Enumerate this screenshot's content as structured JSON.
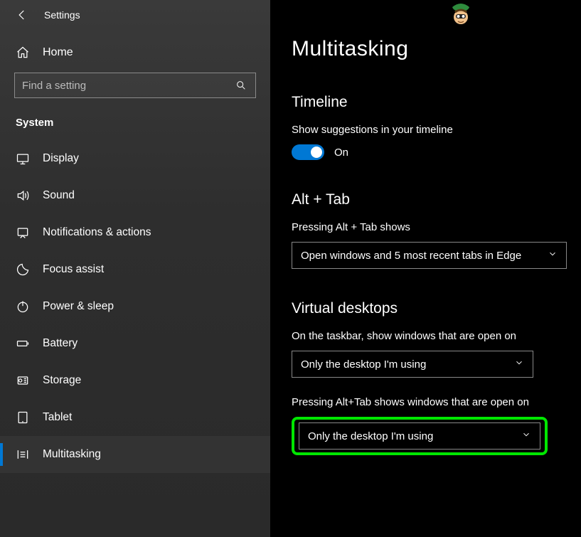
{
  "window": {
    "title": "Settings"
  },
  "sidebar": {
    "home_label": "Home",
    "search_placeholder": "Find a setting",
    "section_label": "System",
    "items": [
      {
        "label": "Display"
      },
      {
        "label": "Sound"
      },
      {
        "label": "Notifications & actions"
      },
      {
        "label": "Focus assist"
      },
      {
        "label": "Power & sleep"
      },
      {
        "label": "Battery"
      },
      {
        "label": "Storage"
      },
      {
        "label": "Tablet"
      },
      {
        "label": "Multitasking"
      }
    ]
  },
  "main": {
    "title": "Multitasking",
    "timeline": {
      "heading": "Timeline",
      "desc": "Show suggestions in your timeline",
      "toggle_state": "On"
    },
    "alttab": {
      "heading": "Alt + Tab",
      "desc": "Pressing Alt + Tab shows",
      "value": "Open windows and 5 most recent tabs in Edge"
    },
    "vdesktops": {
      "heading": "Virtual desktops",
      "desc1": "On the taskbar, show windows that are open on",
      "value1": "Only the desktop I'm using",
      "desc2": "Pressing Alt+Tab shows windows that are open on",
      "value2": "Only the desktop I'm using"
    }
  }
}
